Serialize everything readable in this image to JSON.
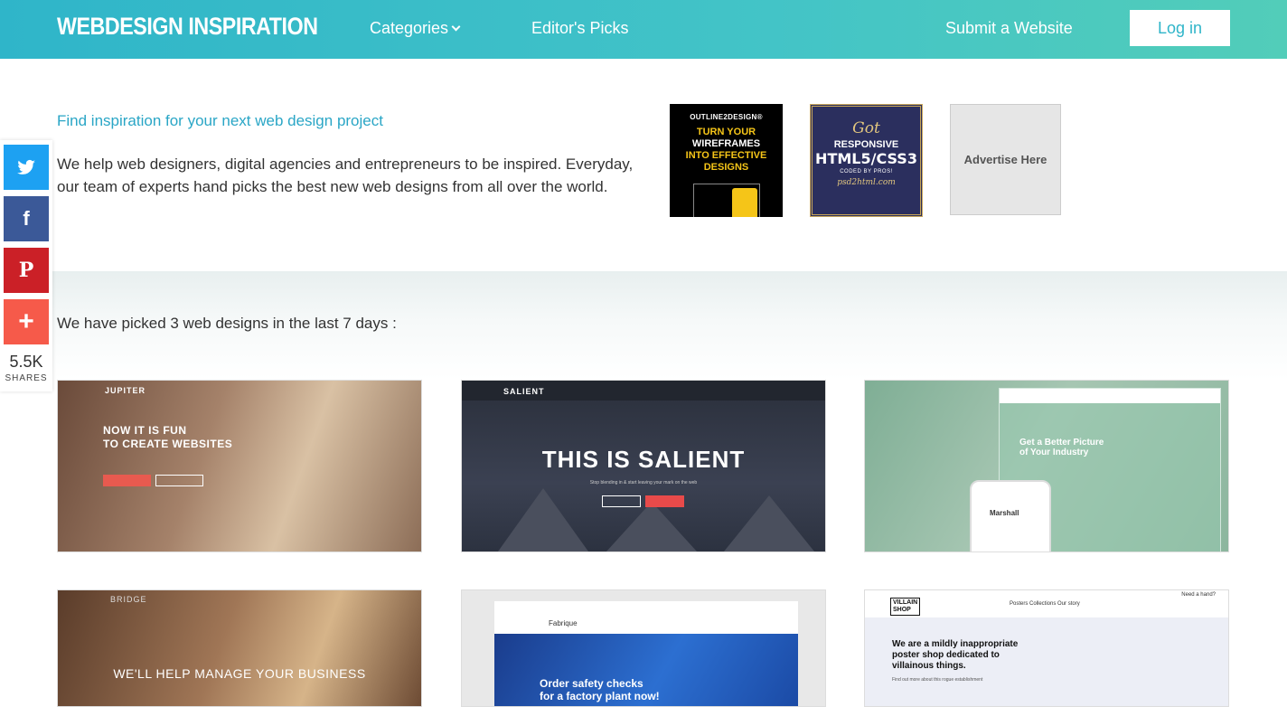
{
  "header": {
    "logo": "WEBDESIGN INSPIRATION",
    "nav": {
      "categories": "Categories",
      "editors_picks": "Editor's Picks",
      "submit": "Submit a Website",
      "login": "Log in"
    }
  },
  "intro": {
    "tagline": "Find inspiration for your next web design project",
    "body": "We help web designers, digital agencies and entrepreneurs to be inspired. Everyday, our team of experts hand picks the best new web designs from all over the world."
  },
  "ads": {
    "ad1": {
      "brand": "OUTLINE2DESIGN®",
      "line1": "TURN YOUR",
      "line2": "WIREFRAMES",
      "line3": "INTO EFFECTIVE",
      "line4": "DESIGNS"
    },
    "ad2": {
      "got": "Got",
      "line1": "RESPONSIVE",
      "line2": "HTML5/CSS3",
      "line3": "CODED BY PROS!",
      "site": "psd2html.com"
    },
    "ad3": {
      "label": "Advertise Here"
    }
  },
  "section": {
    "picked": "We have picked 3 web designs in the last 7 days :"
  },
  "thumbs": [
    {
      "brand": "JUPITER",
      "headline1": "NOW IT IS FUN",
      "headline2": "TO CREATE WEBSITES"
    },
    {
      "brand": "SALIENT",
      "headline": "THIS IS SALIENT",
      "sub": "Stop blending in & start leaving your mark on the web"
    },
    {
      "headline1": "Get a Better Picture",
      "headline2": "of Your Industry",
      "phone": "Marshall"
    },
    {
      "brand": "BRIDGE",
      "headline": "WE'LL HELP MANAGE YOUR BUSINESS"
    },
    {
      "brand": "Fabrique",
      "headline1": "Order safety checks",
      "headline2": "for a factory plant now!"
    },
    {
      "logo1": "VILLAIN",
      "logo2": "SHOP",
      "links": "Posters   Collections   Our story",
      "help": "Need a hand?",
      "headline1": "We are a mildly inappropriate",
      "headline2": "poster shop dedicated to",
      "headline3": "villainous things.",
      "sub": "Find out more about this rogue establishment"
    }
  ],
  "share": {
    "count": "5.5K",
    "label": "SHARES",
    "icons": [
      "twitter-icon",
      "facebook-icon",
      "pinterest-icon",
      "plus-icon"
    ]
  },
  "colors": {
    "header_start": "#2fb5c9",
    "header_end": "#52cdb9",
    "accent": "#2aa6c6",
    "twitter": "#1da1f2",
    "facebook": "#3b5998",
    "pinterest": "#cb2027",
    "more": "#f65a4a"
  }
}
